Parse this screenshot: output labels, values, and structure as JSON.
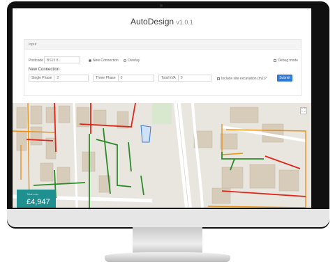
{
  "app": {
    "name": "AutoDesign",
    "version": "v1.0.1"
  },
  "input_panel": {
    "heading": "Input",
    "postcode_label": "Postcode",
    "postcode_value": "BS15 8...",
    "radio_new_connection": "New Connection",
    "radio_other": "Overlay",
    "debug_label": "Debug mode",
    "section_title": "New Connection",
    "single_phase_label": "Single Phase",
    "single_phase_value": "2",
    "three_phase_label": "Three Phase",
    "three_phase_value": "0",
    "total_kva_label": "Total kVA",
    "total_kva_value": "0",
    "include_label": "Include site excavation (m2)?",
    "submit_label": "Submit"
  },
  "map": {
    "cost_value": "£4,947",
    "cost_label": "Total cost",
    "colors": {
      "red": "#e0251b",
      "green": "#2a8a2a",
      "orange": "#e8921e",
      "blue": "#3a7bd5",
      "building": "#d7cbb9",
      "road": "#ffffff"
    }
  }
}
